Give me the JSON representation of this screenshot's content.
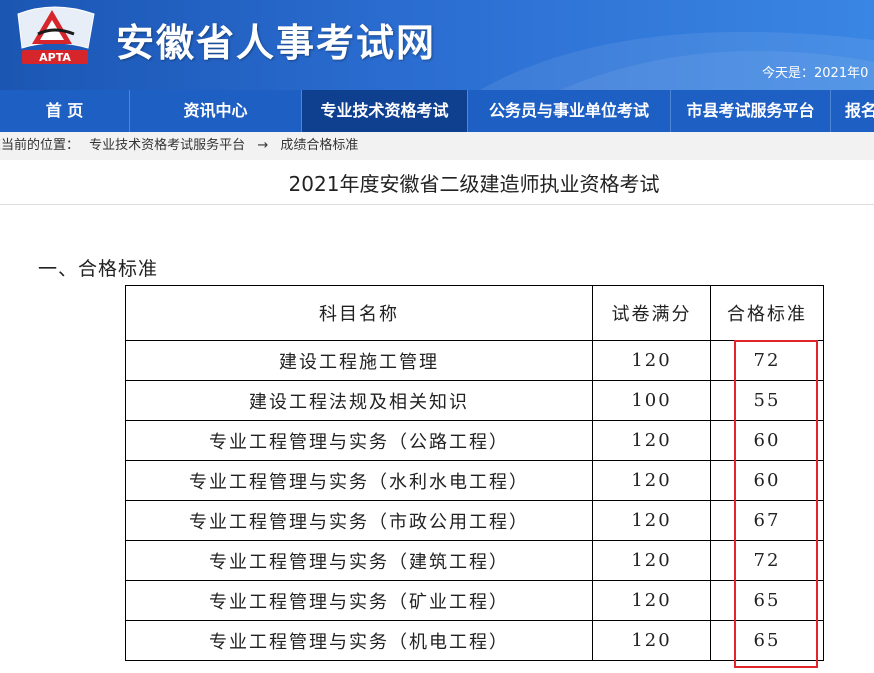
{
  "header": {
    "logo_text": "APTA",
    "site_title": "安徽省人事考试网",
    "today_label": "今天是：2021年0"
  },
  "nav": {
    "items": [
      {
        "label": "首  页",
        "active": false
      },
      {
        "label": "资讯中心",
        "active": false
      },
      {
        "label": "专业技术资格考试",
        "active": true
      },
      {
        "label": "公务员与事业单位考试",
        "active": false
      },
      {
        "label": "市县考试服务平台",
        "active": false
      },
      {
        "label": "报名",
        "active": false
      }
    ]
  },
  "breadcrumb": {
    "prefix": "您当前的位置：",
    "items": [
      "专业技术资格考试服务平台",
      "成绩合格标准"
    ],
    "separator": "→"
  },
  "page_title": "2021年度安徽省二级建造师执业资格考试",
  "section_title": "一、合格标准",
  "table": {
    "headers": [
      "科目名称",
      "试卷满分",
      "合格标准"
    ],
    "rows": [
      {
        "subject": "建设工程施工管理",
        "full": "120",
        "pass": "72"
      },
      {
        "subject": "建设工程法规及相关知识",
        "full": "100",
        "pass": "55"
      },
      {
        "subject": "专业工程管理与实务（公路工程）",
        "full": "120",
        "pass": "60"
      },
      {
        "subject": "专业工程管理与实务（水利水电工程）",
        "full": "120",
        "pass": "60"
      },
      {
        "subject": "专业工程管理与实务（市政公用工程）",
        "full": "120",
        "pass": "67"
      },
      {
        "subject": "专业工程管理与实务（建筑工程）",
        "full": "120",
        "pass": "72"
      },
      {
        "subject": "专业工程管理与实务（矿业工程）",
        "full": "120",
        "pass": "65"
      },
      {
        "subject": "专业工程管理与实务（机电工程）",
        "full": "120",
        "pass": "65"
      }
    ]
  },
  "colors": {
    "header_blue": "#1b56b3",
    "nav_blue": "#1e5fc4",
    "nav_active": "#0f3f8f",
    "highlight_red": "#e0262b"
  }
}
